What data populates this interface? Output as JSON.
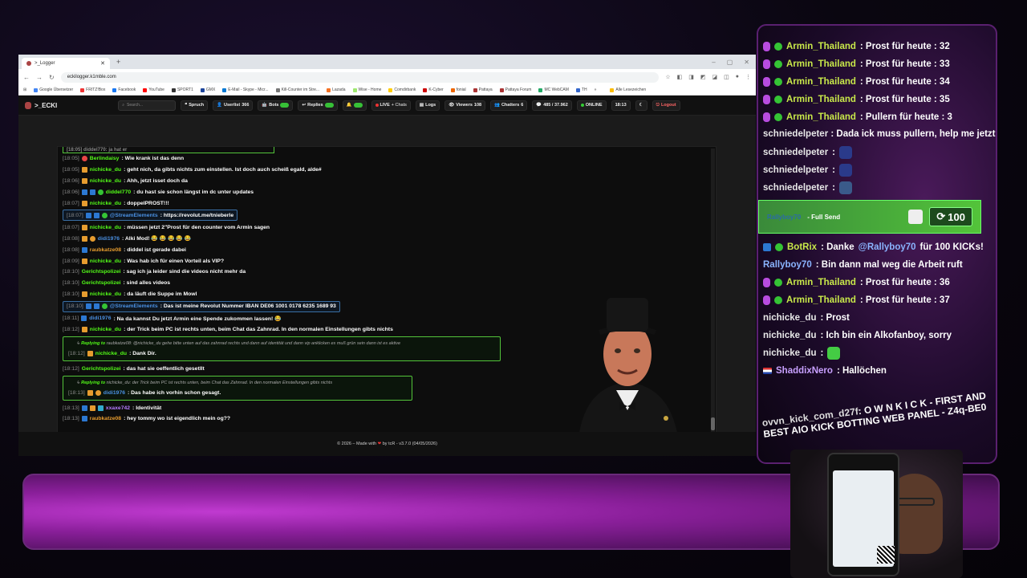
{
  "browser": {
    "tab_title": ">_Logger",
    "url": "eckilogger.k1mble.com",
    "bookmarks": [
      "Google Übersetzer",
      "FRITZ!Box",
      "Facebook",
      "YouTube",
      "SPORT1",
      "GMX",
      "E-Mail - Skype - Micr...",
      "Kill-Counter im Stre...",
      "Lazada",
      "Wise - Home",
      "Comdirbank",
      "K-Cyber",
      "fonial",
      "Pattaya",
      "Pattaya Forum",
      "MC WebCAM",
      "TH"
    ],
    "bookmarks_more": "Alle Lesezeichen"
  },
  "nav": {
    "brand": ">_ECKI",
    "search_placeholder": "Search...",
    "spruch": "Spruch",
    "userlist": "Userlist",
    "userlist_count": "366",
    "bots": "Bots",
    "replies": "Replies",
    "live": "LIVE",
    "chats": "+ Chats",
    "logs": "Logs",
    "viewers": "Viewers",
    "viewers_count": "108",
    "chatters": "Chatters",
    "chatters_count": "6",
    "messages": "485 / 37.962",
    "status": "ONLINE",
    "time": "18:13",
    "logout": "Logout"
  },
  "chat": {
    "lines": [
      {
        "ts": "[18:05]",
        "nick": "Berlindaisy",
        "msg": ": Wie krank ist das denn"
      },
      {
        "ts": "[18:05]",
        "nick": "nichicke_du",
        "msg": ": geht nich, da gibts nichts zum einstellen. Ist doch auch scheiß egald, alde#"
      },
      {
        "ts": "[18:06]",
        "nick": "nichicke_du",
        "msg": ": Ahh, jetzt isset doch da"
      },
      {
        "ts": "[18:06]",
        "nick": "diddel770",
        "msg": ": du hast sie schon längst im dc unter updates"
      },
      {
        "ts": "[18:07]",
        "nick": "nichicke_du",
        "msg": ": doppelPROST!!!"
      },
      {
        "ts": "[18:07]",
        "nick": "@StreamElements",
        "msg": ": https://revolut.me/tnieberle"
      },
      {
        "ts": "[18:07]",
        "nick": "nichicke_du",
        "msg": ": müssen jetzt 2\"Prost für den counter vom Armin sagen"
      },
      {
        "ts": "[18:08]",
        "nick": "didi1976",
        "msg": ": Alki Mod! 😂 😂 😂 😂 😂"
      },
      {
        "ts": "[18:08]",
        "nick": "raubkatze08",
        "msg": ": diddel ist gerade dabei"
      },
      {
        "ts": "[18:09]",
        "nick": "nichicke_du",
        "msg": ": Was hab ich für einen Vorteil als VIP?"
      },
      {
        "ts": "[18:10]",
        "nick": "Gerichtspolizei",
        "msg": ": sag ich ja leider sind die videos nicht mehr da"
      },
      {
        "ts": "[18:10]",
        "nick": "Gerichtspolizei",
        "msg": ": sind alles videos"
      },
      {
        "ts": "[18:10]",
        "nick": "nichicke_du",
        "msg": ": da läuft die Suppe im Mowl"
      },
      {
        "ts": "[18:10]",
        "nick": "@StreamElements",
        "msg": ": Das ist meine Revolut Nummer IBAN DE06 1001 0178 6235 1689 93"
      },
      {
        "ts": "[18:11]",
        "nick": "didi1976",
        "msg": ": Na da kannst Du jetzt Armin eine Spende zukommen lassen! 😂"
      },
      {
        "ts": "[18:12]",
        "nick": "nichicke_du",
        "msg": ": der Trick beim PC ist rechts unten, beim Chat das Zahnrad. In den normalen Einstellungen gibts nichts"
      },
      {
        "ts": "[18:12]",
        "nick": "nichicke_du",
        "msg": ": Dank Dir.",
        "reply_to": "raubkatze08",
        "reply_text": ": @nichicke_du gehe bitte unten auf das zahnrad rechts und dann auf identität und dann vip anklicken es muß grün sein dann ist es aktive"
      },
      {
        "ts": "[18:12]",
        "nick": "Gerichtspolizei",
        "msg": ": das hat sie oeffentlich gesetllt"
      },
      {
        "ts": "[18:13]",
        "nick": "didi1976",
        "msg": ": Das habe ich vorhin schon gesagt.",
        "reply_to": "nichicke_du",
        "reply_text": ": der Trick beim PC ist rechts unten, beim Chat das Zahnrad. In den normalen Einstellungen gibts nichts"
      },
      {
        "ts": "[18:13]",
        "nick": "xxaxe742",
        "msg": ": Identivität"
      },
      {
        "ts": "[18:13]",
        "nick": "raubkatze08",
        "msg": ": hey tommy wo ist eigendlich mein og??"
      }
    ],
    "top_partial": "[18:05] diddel770: ja hat er",
    "replying_label": "Replying to"
  },
  "footer": {
    "prefix": "© 2026 – Made with",
    "by": "by tcR",
    "version": "- v3.7.0 (04/05/2026)"
  },
  "stream_chat": {
    "lines": [
      {
        "nick": "Armin_Thailand",
        "msg": ": Prost für heute : 32"
      },
      {
        "nick": "Armin_Thailand",
        "msg": ": Prost für heute : 33"
      },
      {
        "nick": "Armin_Thailand",
        "msg": ": Prost für heute : 34"
      },
      {
        "nick": "Armin_Thailand",
        "msg": ": Prost für heute : 35"
      },
      {
        "nick": "Armin_Thailand",
        "msg": ": Pullern für heute : 3"
      },
      {
        "nick": "schniedelpeter",
        "msg": ": Dada ick muss pullern, help me jetzt"
      },
      {
        "nick": "schniedelpeter",
        "msg": ":"
      },
      {
        "nick": "schniedelpeter",
        "msg": ":"
      },
      {
        "nick": "schniedelpeter",
        "msg": ":"
      },
      {
        "nick": "BotRix",
        "msg": ": Danke",
        "mention": "@Rallyboy70",
        "msg2": "für 100 KICKs!"
      },
      {
        "nick": "Rallyboy70",
        "msg": ": Bin dann mal weg die Arbeit ruft"
      },
      {
        "nick": "Armin_Thailand",
        "msg": ": Prost für heute : 36"
      },
      {
        "nick": "Armin_Thailand",
        "msg": ": Prost für heute : 37"
      },
      {
        "nick": "nichicke_du",
        "msg": ": Prost"
      },
      {
        "nick": "nichicke_du",
        "msg": ": Ich bin ein Alkofanboy, sorry"
      },
      {
        "nick": "nichicke_du",
        "msg": ":"
      },
      {
        "nick": "ShaddixNero",
        "msg": ": Hallöchen"
      }
    ],
    "gift": {
      "user": "Rallyboy70",
      "label": "- Full Send",
      "amount": "100"
    },
    "spam_nick": "ovvn_kick_com_d27f",
    "spam_text": ": O W N K I C K - FIRST AND BEST AIO KICK BOTTING WEB PANEL - Z4q-BE0"
  }
}
